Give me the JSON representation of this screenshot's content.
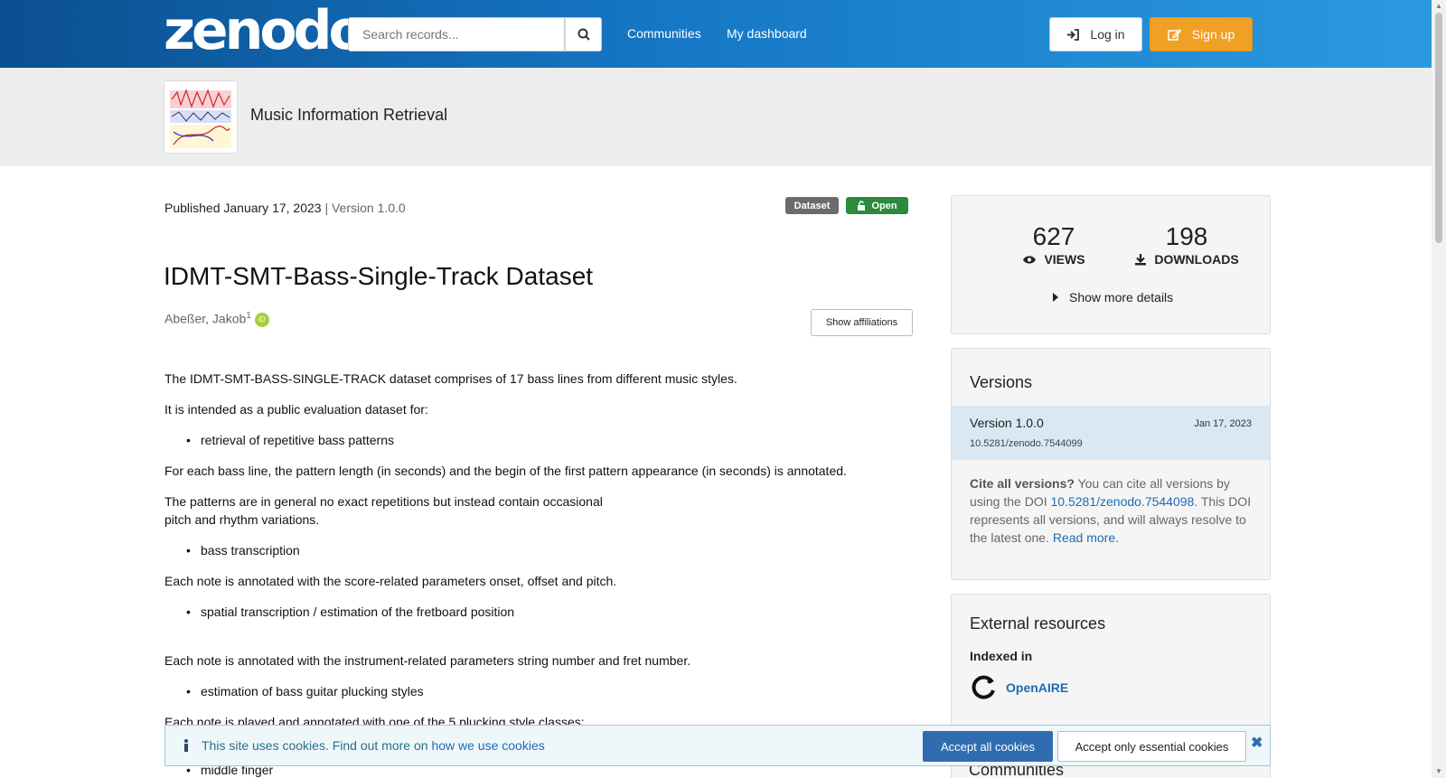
{
  "header": {
    "logo": "zenodo",
    "search_placeholder": "Search records...",
    "nav": [
      "Communities",
      "My dashboard"
    ],
    "login_label": "Log in",
    "signup_label": "Sign up"
  },
  "community": {
    "name": "Music Information Retrieval"
  },
  "record": {
    "published": "Published January 17, 2023",
    "version_suffix": "| Version 1.0.0",
    "badge_type": "Dataset",
    "badge_access": "Open",
    "title": "IDMT-SMT-Bass-Single-Track Dataset",
    "author": "Abeßer, Jakob",
    "author_sup": "1",
    "show_affiliations": "Show affiliations",
    "description": {
      "p1": "The IDMT-SMT-BASS-SINGLE-TRACK dataset comprises of 17 bass lines from different music styles.",
      "p2": "It is intended as a public evaluation dataset for:",
      "li1": "retrieval of repetitive bass patterns",
      "p3": "For each bass line, the pattern length (in seconds) and the begin of the first pattern appearance (in seconds) is annotated.",
      "p4a": "The patterns are in general no exact repetitions but instead contain occasional",
      "p4b": "pitch and rhythm variations.",
      "li2": "bass transcription",
      "p5": "Each note is annotated with the score-related parameters onset, offset and pitch.",
      "li3": "spatial transcription / estimation of the fretboard position",
      "p6": "Each note is annotated with the instrument-related parameters string number and fret number.",
      "li4": "estimation of bass guitar plucking styles",
      "p7": "Each note is played and annotated with one of the 5 plucking style classes:",
      "li5": "middle finger"
    }
  },
  "stats": {
    "views": "627",
    "views_label": "VIEWS",
    "downloads": "198",
    "downloads_label": "DOWNLOADS",
    "more_details": "Show more details"
  },
  "versions": {
    "title": "Versions",
    "current_name": "Version 1.0.0",
    "current_date": "Jan 17, 2023",
    "current_doi": "10.5281/zenodo.7544099",
    "cite_bold": "Cite all versions?",
    "cite_text1": " You can cite all versions by using the DOI ",
    "cite_doi": "10.5281/zenodo.7544098",
    "cite_text2": ". This DOI represents all versions, and will always resolve to the latest one. ",
    "read_more": "Read more",
    "period": "."
  },
  "external": {
    "title": "External resources",
    "indexed_in": "Indexed in",
    "openaire": "OpenAIRE"
  },
  "communities_title": "Communities",
  "cookie": {
    "text": "This site uses cookies. Find out more on ",
    "link": "how we use cookies",
    "accept_all": "Accept all cookies",
    "accept_essential": "Accept only essential cookies"
  },
  "colors": {
    "header_start": "#0b4f8f",
    "header_end": "#2a9ae0",
    "signup": "#f0a024",
    "open_badge": "#2b8a3e",
    "link": "#1f6bb3"
  }
}
